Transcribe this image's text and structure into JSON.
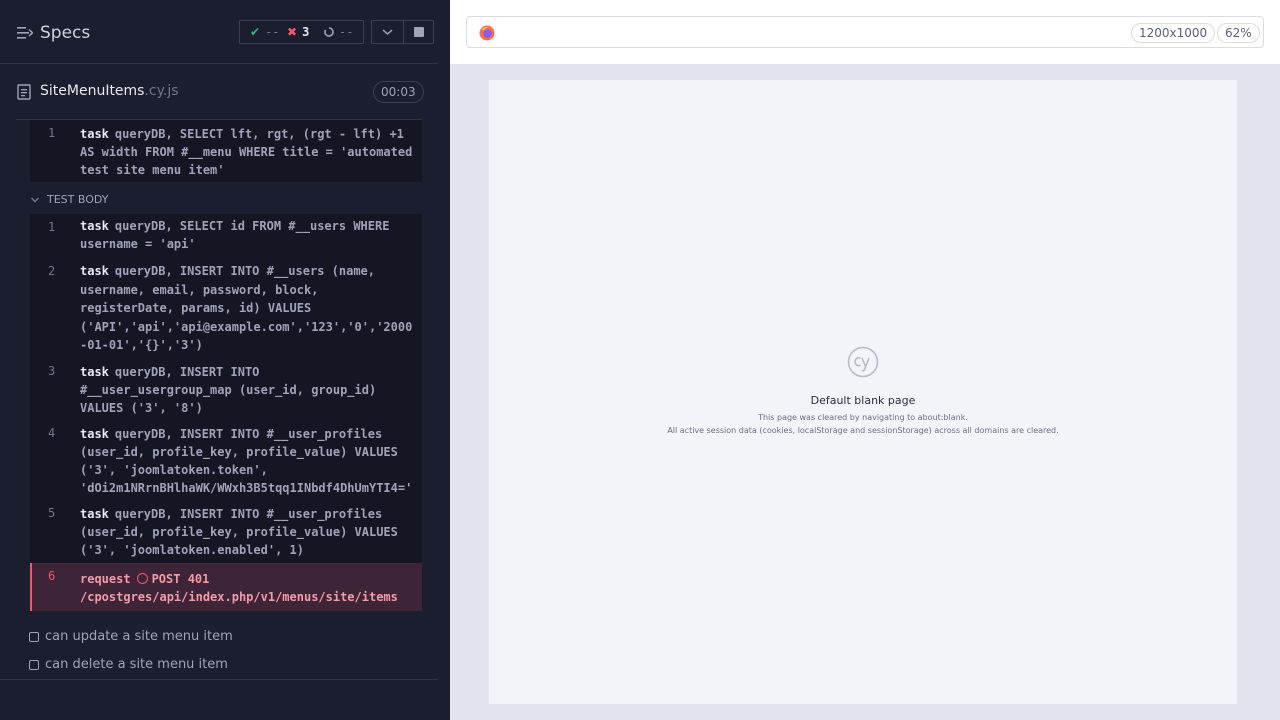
{
  "reporter": {
    "title": "Specs",
    "stats": {
      "passed": "--",
      "failed": "3",
      "pending": "--"
    },
    "file": {
      "name": "SiteMenuItems",
      "ext": ".cy.js",
      "duration": "00:03"
    },
    "before_commands": [
      {
        "num": "1",
        "name": "task",
        "message": "queryDB, SELECT lft, rgt, (rgt - lft) +1 AS width FROM #__menu WHERE title = 'automated test site menu item'"
      }
    ],
    "test_body_label": "TEST BODY",
    "commands": [
      {
        "num": "1",
        "name": "task",
        "message": "queryDB, SELECT id FROM #__users WHERE username = 'api'"
      },
      {
        "num": "2",
        "name": "task",
        "message": "queryDB, INSERT INTO #__users (name, username, email, password, block, registerDate, params, id) VALUES ('API','api','api@example.com','123','0','2000-01-01','{}','3')"
      },
      {
        "num": "3",
        "name": "task",
        "message": "queryDB, INSERT INTO #__user_usergroup_map (user_id, group_id) VALUES ('3', '8')"
      },
      {
        "num": "4",
        "name": "task",
        "message": "queryDB, INSERT INTO #__user_profiles (user_id, profile_key, profile_value) VALUES ('3', 'joomlatoken.token', 'dOi2m1NRrnBHlhaWK/WWxh3B5tqq1INbdf4DhUmYTI4=')"
      },
      {
        "num": "5",
        "name": "task",
        "message": "queryDB, INSERT INTO #__user_profiles (user_id, profile_key, profile_value) VALUES ('3', 'joomlatoken.enabled', 1)"
      }
    ],
    "failed_command": {
      "num": "6",
      "name": "request",
      "message": "POST 401 /cpostgres/api/index.php/v1/menus/site/items"
    },
    "tests": [
      {
        "label": "can update a site menu item"
      },
      {
        "label": "can delete a site menu item"
      }
    ]
  },
  "aut": {
    "viewport": "1200x1000",
    "zoom": "62%",
    "blank_title": "Default blank page",
    "blank_line1": "This page was cleared by navigating to about:blank.",
    "blank_line2": "All active session data (cookies, localStorage and sessionStorage) across all domains are cleared."
  },
  "colors": {
    "panel_bg": "#1b1e2e",
    "pass": "#2fb78a",
    "fail": "#f1586e",
    "aut_bg": "#e1e3ed"
  }
}
